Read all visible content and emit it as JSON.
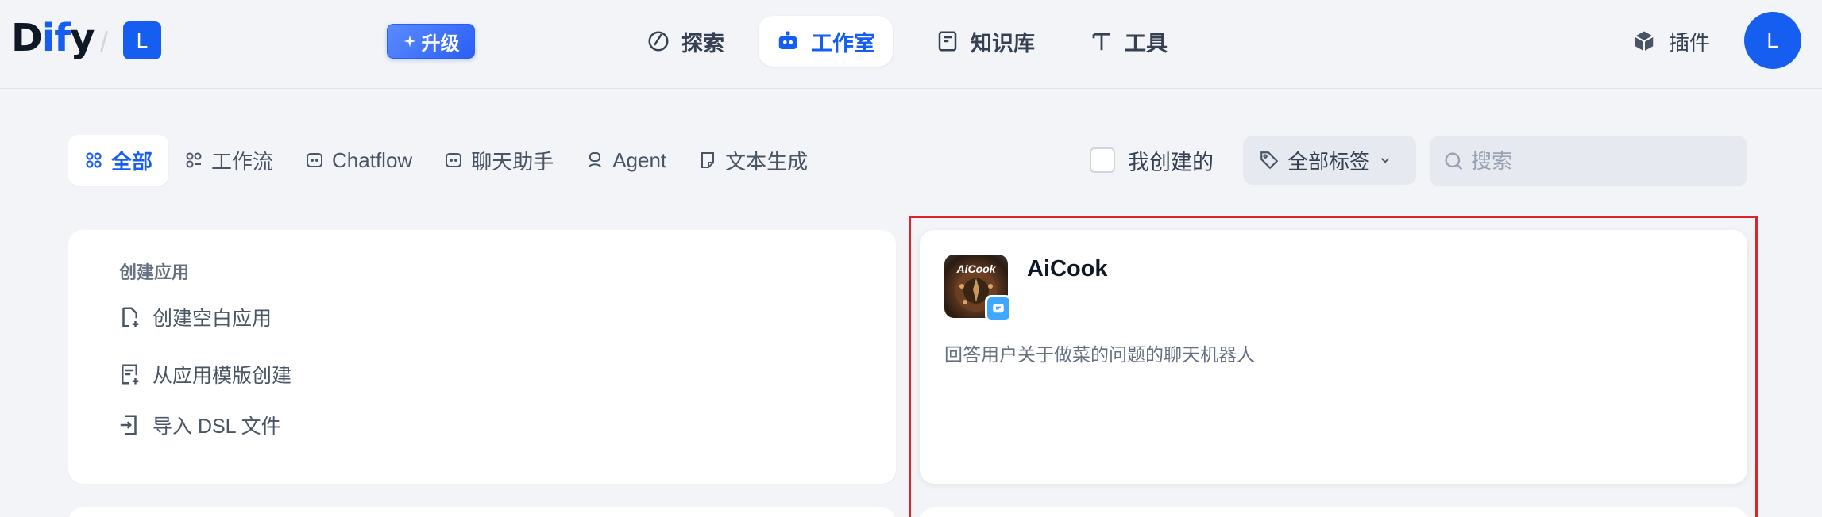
{
  "brand": {
    "logo_d": "D",
    "logo_if": "if",
    "logo_y": "y",
    "separator": "/",
    "workspace_initial": "L"
  },
  "header": {
    "upgrade_label": "升级",
    "nav": [
      {
        "label": "探索",
        "icon": "explore-icon"
      },
      {
        "label": "工作室",
        "icon": "robot-icon",
        "active": true
      },
      {
        "label": "知识库",
        "icon": "book-icon"
      },
      {
        "label": "工具",
        "icon": "hammer-icon"
      }
    ],
    "plugin_label": "插件",
    "user_initial": "L"
  },
  "filters": {
    "tabs": [
      {
        "label": "全部",
        "active": true
      },
      {
        "label": "工作流"
      },
      {
        "label": "Chatflow"
      },
      {
        "label": "聊天助手"
      },
      {
        "label": "Agent"
      },
      {
        "label": "文本生成"
      }
    ],
    "mine_label": "我创建的",
    "tag_label": "全部标签",
    "search_placeholder": "搜索"
  },
  "create_card": {
    "title": "创建应用",
    "items": [
      "创建空白应用",
      "从应用模版创建",
      "导入 DSL 文件"
    ]
  },
  "app_card": {
    "name": "AiCook",
    "thumb_text": "AiCook",
    "description": "回答用户关于做菜的问题的聊天机器人",
    "type_badge": "chat-bubble-icon"
  },
  "colors": {
    "accent": "#155eef",
    "highlight": "#d9262e",
    "background": "#f2f4f7"
  }
}
